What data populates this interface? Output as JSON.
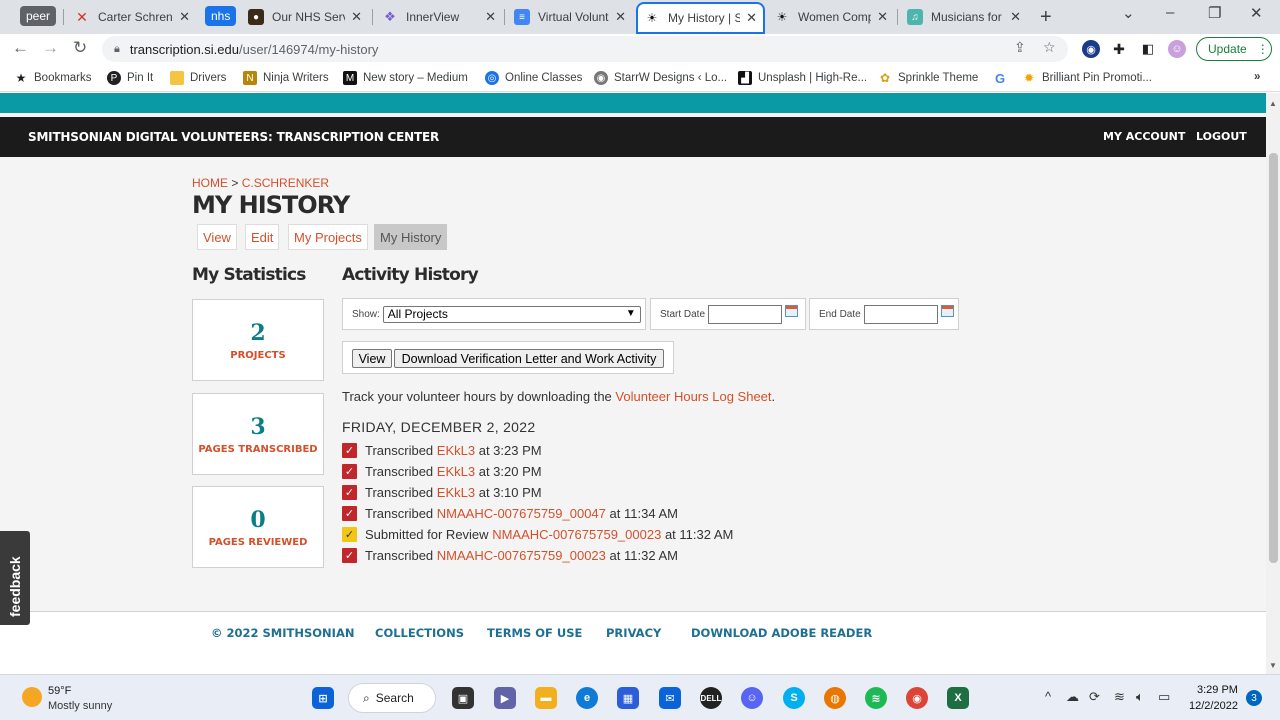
{
  "browser": {
    "tabs": [
      {
        "title": "Carter Schrenk",
        "icon": "x-logo-icon"
      },
      {
        "title": "Our NHS Servi",
        "icon": "nhs-favicon-icon"
      },
      {
        "title": "InnerView",
        "icon": "innerview-favicon-icon"
      },
      {
        "title": "Virtual Volunte",
        "icon": "google-docs-icon"
      },
      {
        "title": "My History | S",
        "icon": "smithsonian-favicon-icon",
        "active": true
      },
      {
        "title": "Women Comp",
        "icon": "smithsonian-favicon-icon"
      },
      {
        "title": "Musicians for",
        "icon": "musicians-favicon-icon"
      }
    ],
    "group_chips": {
      "peer": "peer",
      "nhs": "nhs"
    },
    "url_host": "transcription.si.edu",
    "url_path": "/user/146974/my-history",
    "update_label": "Update",
    "bookmarks": [
      {
        "label": "Bookmarks",
        "icon": "star-icon"
      },
      {
        "label": "Pin It",
        "icon": "pinterest-icon"
      },
      {
        "label": "Drivers",
        "icon": "folder-icon"
      },
      {
        "label": "Ninja Writers",
        "icon": "ninja-icon"
      },
      {
        "label": "New story – Medium",
        "icon": "medium-icon"
      },
      {
        "label": "Online Classes",
        "icon": "classes-icon"
      },
      {
        "label": "StarrW Designs ‹ Lo...",
        "icon": "starrw-icon"
      },
      {
        "label": "Unsplash | High-Re...",
        "icon": "unsplash-icon"
      },
      {
        "label": "Sprinkle Theme",
        "icon": "sprinkle-icon"
      },
      {
        "label": "",
        "icon": "google-icon"
      },
      {
        "label": "Brilliant Pin Promoti...",
        "icon": "brilliant-pin-icon"
      }
    ]
  },
  "site": {
    "header_title": "SMITHSONIAN DIGITAL VOLUNTEERS: TRANSCRIPTION CENTER",
    "my_account": "MY ACCOUNT",
    "logout": "LOGOUT",
    "breadcrumb_home": "HOME",
    "breadcrumb_sep": ">",
    "breadcrumb_user": "C.SCHRENKER",
    "page_title": "MY HISTORY",
    "tabs": [
      {
        "label": "View"
      },
      {
        "label": "Edit"
      },
      {
        "label": "My Projects"
      },
      {
        "label": "My History",
        "active": true
      }
    ],
    "stats_title": "My Statistics",
    "stats": [
      {
        "value": "2",
        "label": "PROJECTS"
      },
      {
        "value": "3",
        "label": "PAGES TRANSCRIBED"
      },
      {
        "value": "0",
        "label": "PAGES REVIEWED"
      }
    ],
    "activity_title": "Activity History",
    "filters": {
      "show_label": "Show:",
      "show_value": "All Projects",
      "start_label": "Start Date",
      "end_label": "End Date"
    },
    "buttons": {
      "view": "View",
      "download": "Download Verification Letter and Work Activity"
    },
    "track_prefix": "Track your volunteer hours by downloading the ",
    "track_link": "Volunteer Hours Log Sheet",
    "track_suffix": ".",
    "date_heading": "FRIDAY, DECEMBER 2, 2022",
    "activities": [
      {
        "action": "Transcribed",
        "item": "EKkL3",
        "time": "at 3:23 PM",
        "status": "red"
      },
      {
        "action": "Transcribed",
        "item": "EKkL3",
        "time": "at 3:20 PM",
        "status": "red"
      },
      {
        "action": "Transcribed",
        "item": "EKkL3",
        "time": "at 3:10 PM",
        "status": "red"
      },
      {
        "action": "Transcribed",
        "item": "NMAAHC-007675759_00047",
        "time": "at 11:34 AM",
        "status": "red"
      },
      {
        "action": "Submitted for Review",
        "item": "NMAAHC-007675759_00023",
        "time": "at 11:32 AM",
        "status": "yellow"
      },
      {
        "action": "Transcribed",
        "item": "NMAAHC-007675759_00023",
        "time": "at 11:32 AM",
        "status": "red"
      }
    ],
    "footer": {
      "copyright": "© 2022 SMITHSONIAN",
      "collections": "COLLECTIONS",
      "terms": "TERMS OF USE",
      "privacy": "PRIVACY",
      "adobe": "DOWNLOAD ADOBE READER"
    },
    "feedback": "feedback"
  },
  "taskbar": {
    "temp": "59°F",
    "weather": "Mostly sunny",
    "search": "Search",
    "time": "3:29 PM",
    "date": "12/2/2022",
    "notifications": "3"
  },
  "colors": {
    "accent_orange": "#d4502a",
    "teal": "#0a9aa6",
    "stat_teal": "#0a7d86",
    "header_black": "#1b1b1b",
    "footer_blue": "#1e6f92"
  }
}
